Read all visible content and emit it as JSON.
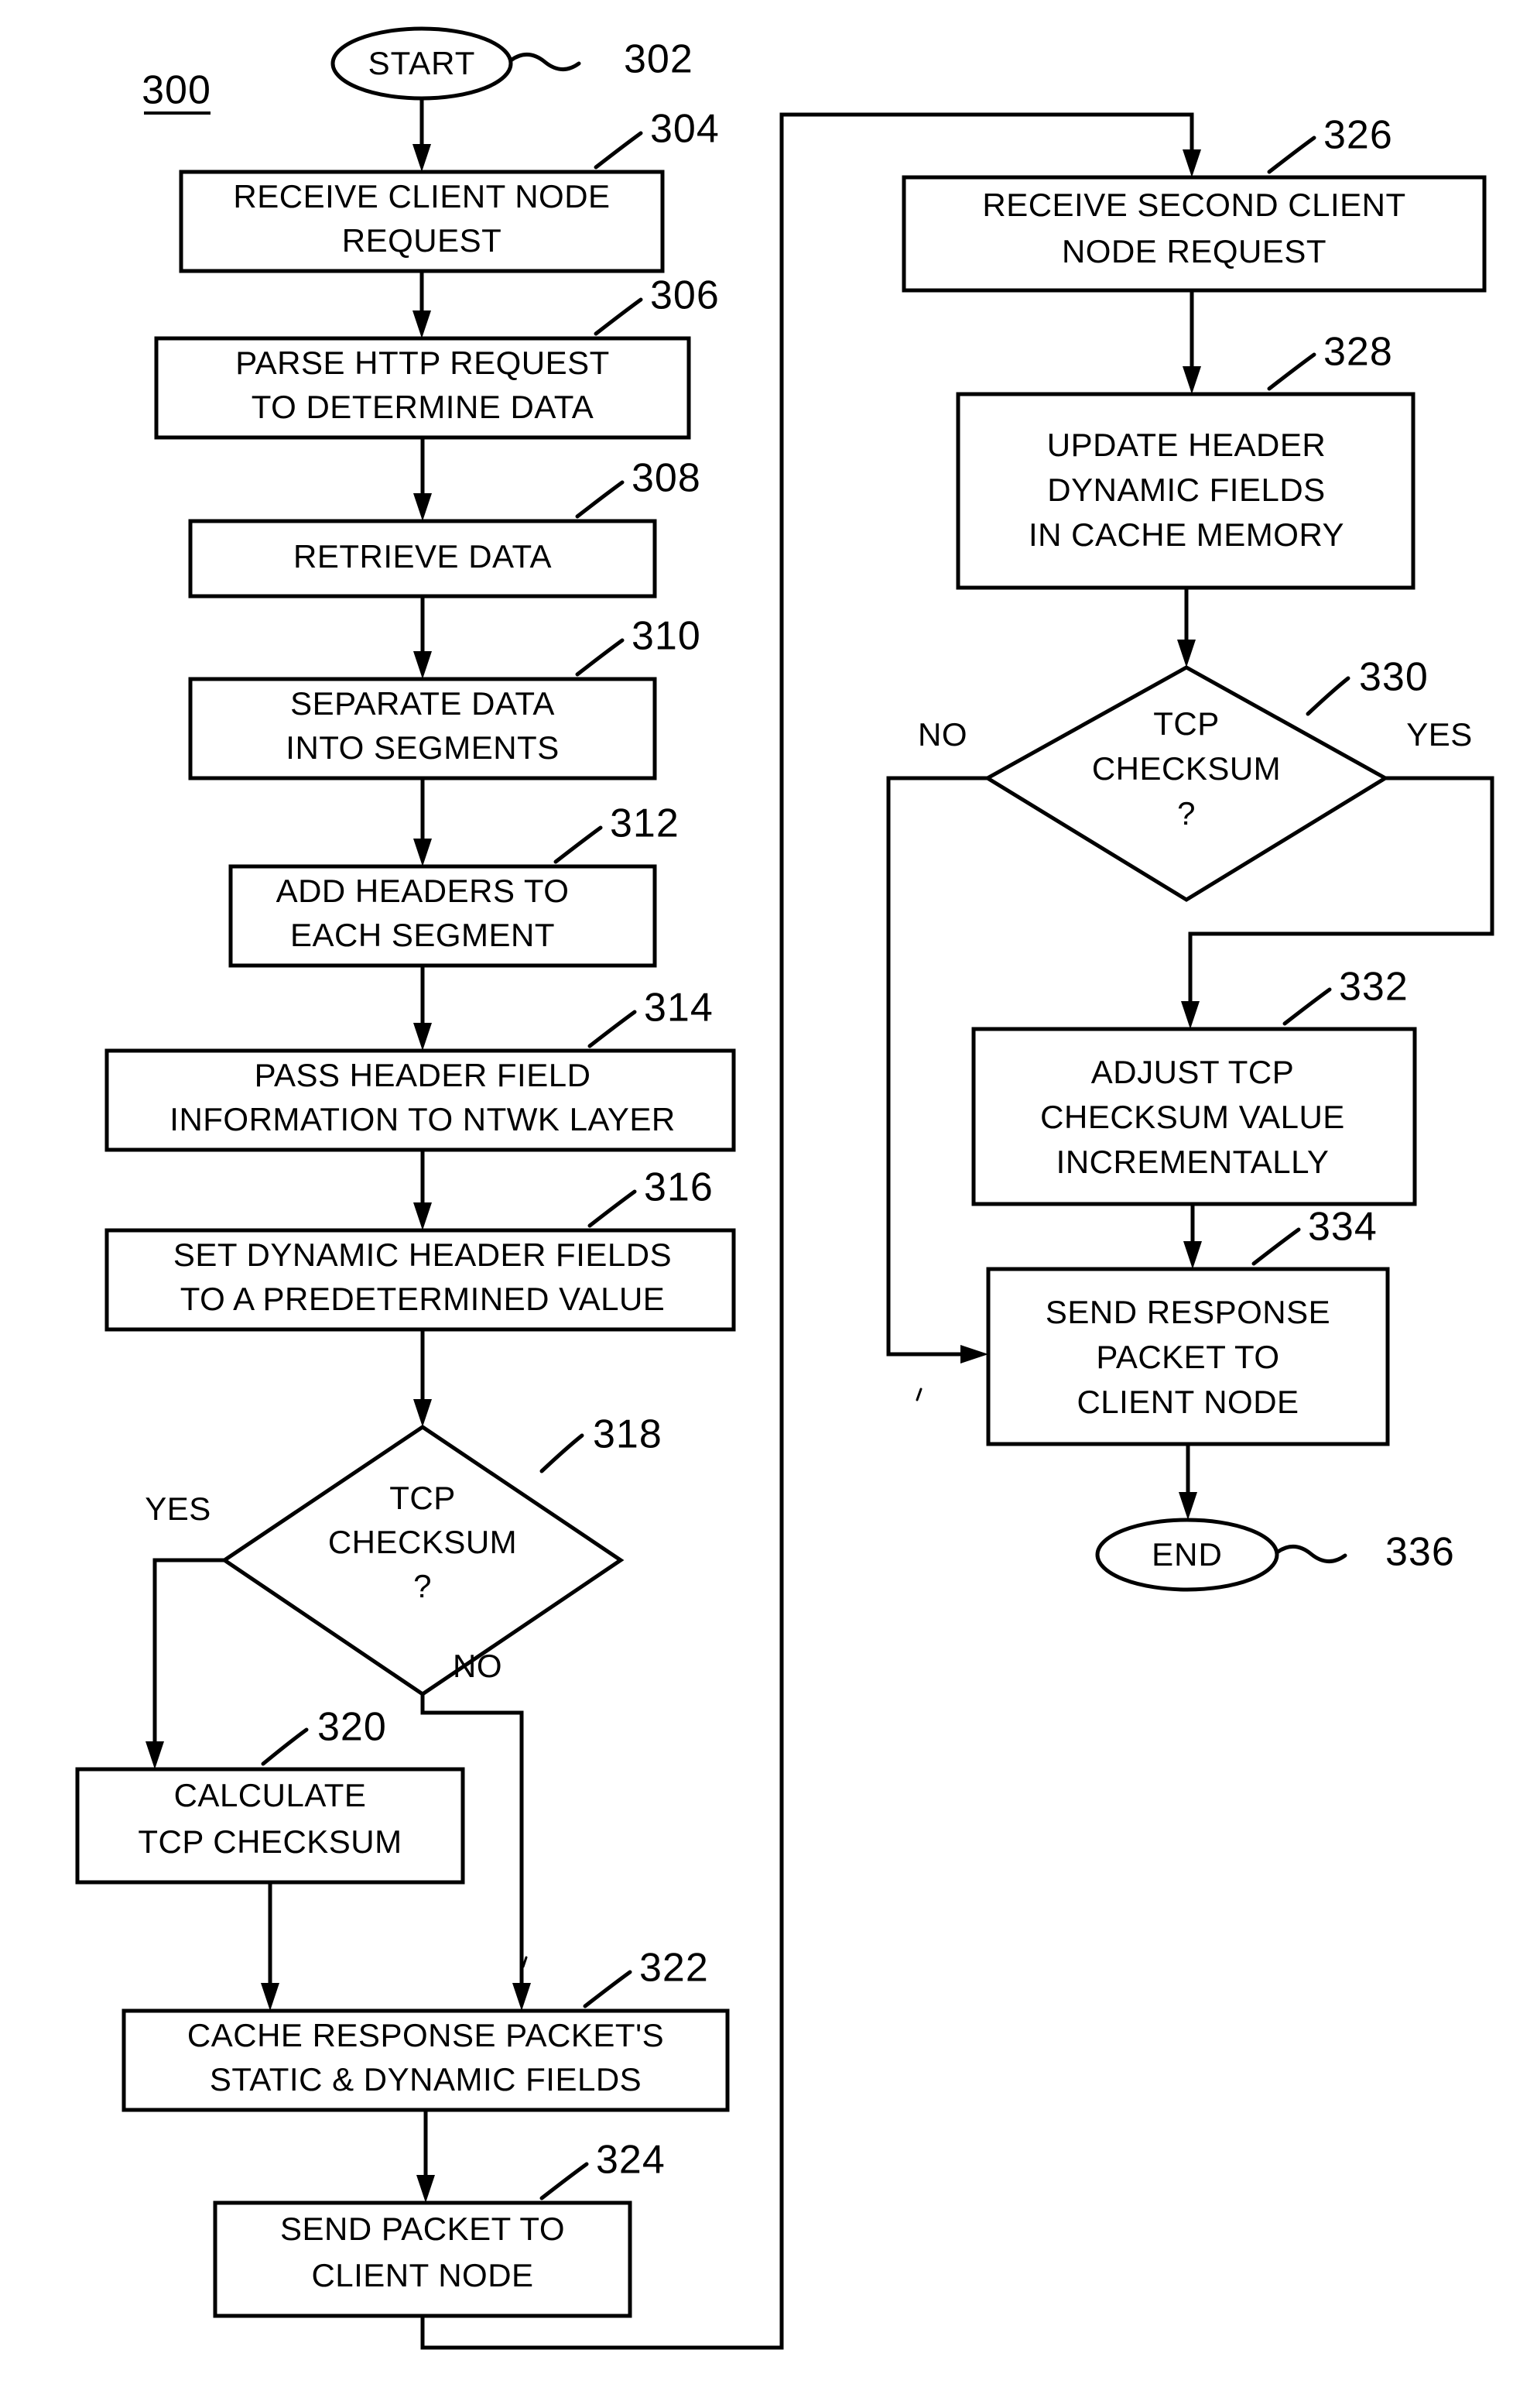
{
  "figure": {
    "number": "300",
    "type": "flowchart"
  },
  "nodes": {
    "start": {
      "ref": "302",
      "label": "START",
      "shape": "oval"
    },
    "n304": {
      "ref": "304",
      "lines": [
        "RECEIVE CLIENT NODE",
        "REQUEST"
      ],
      "shape": "process"
    },
    "n306": {
      "ref": "306",
      "lines": [
        "PARSE HTTP REQUEST",
        "TO DETERMINE DATA"
      ],
      "shape": "process"
    },
    "n308": {
      "ref": "308",
      "lines": [
        "RETRIEVE DATA"
      ],
      "shape": "process"
    },
    "n310": {
      "ref": "310",
      "lines": [
        "SEPARATE DATA",
        "INTO SEGMENTS"
      ],
      "shape": "process"
    },
    "n312": {
      "ref": "312",
      "lines": [
        "ADD HEADERS TO",
        "EACH SEGMENT"
      ],
      "shape": "process"
    },
    "n314": {
      "ref": "314",
      "lines": [
        "PASS HEADER FIELD",
        "INFORMATION TO NTWK LAYER"
      ],
      "shape": "process"
    },
    "n316": {
      "ref": "316",
      "lines": [
        "SET DYNAMIC HEADER FIELDS",
        "TO A PREDETERMINED VALUE"
      ],
      "shape": "process"
    },
    "n318": {
      "ref": "318",
      "lines": [
        "TCP",
        "CHECKSUM",
        "?"
      ],
      "shape": "decision",
      "yes_label": "YES",
      "no_label": "NO"
    },
    "n320": {
      "ref": "320",
      "lines": [
        "CALCULATE",
        "TCP CHECKSUM"
      ],
      "shape": "process"
    },
    "n322": {
      "ref": "322",
      "lines": [
        "CACHE RESPONSE PACKET'S",
        "STATIC & DYNAMIC FIELDS"
      ],
      "shape": "process"
    },
    "n324": {
      "ref": "324",
      "lines": [
        "SEND PACKET TO",
        "CLIENT NODE"
      ],
      "shape": "process"
    },
    "n326": {
      "ref": "326",
      "lines": [
        "RECEIVE SECOND CLIENT",
        "NODE REQUEST"
      ],
      "shape": "process"
    },
    "n328": {
      "ref": "328",
      "lines": [
        "UPDATE HEADER",
        "DYNAMIC FIELDS",
        "IN CACHE MEMORY"
      ],
      "shape": "process"
    },
    "n330": {
      "ref": "330",
      "lines": [
        "TCP",
        "CHECKSUM",
        "?"
      ],
      "shape": "decision",
      "yes_label": "YES",
      "no_label": "NO"
    },
    "n332": {
      "ref": "332",
      "lines": [
        "ADJUST TCP",
        "CHECKSUM VALUE",
        "INCREMENTALLY"
      ],
      "shape": "process"
    },
    "n334": {
      "ref": "334",
      "lines": [
        "SEND RESPONSE",
        "PACKET TO",
        "CLIENT NODE"
      ],
      "shape": "process"
    },
    "end": {
      "ref": "336",
      "label": "END",
      "shape": "oval"
    }
  },
  "colors": {
    "stroke": "#000000",
    "fill": "#ffffff",
    "text": "#000000"
  }
}
